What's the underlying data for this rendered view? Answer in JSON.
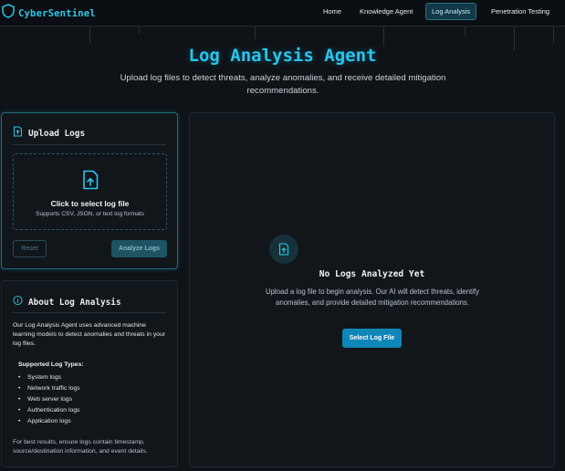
{
  "nav": {
    "brand": "CyberSentinel",
    "links": [
      {
        "label": "Home"
      },
      {
        "label": "Knowledge Agent"
      },
      {
        "label": "Log Analysis"
      },
      {
        "label": "Penetration Testing"
      }
    ],
    "active": "Log Analysis"
  },
  "hero": {
    "title": "Log Analysis Agent",
    "subtitle": "Upload log files to detect threats, analyze anomalies, and receive detailed mitigation recommendations."
  },
  "upload": {
    "title": "Upload Logs",
    "dropzone_title": "Click to select log file",
    "dropzone_sub": "Supports CSV, JSON, or text log formats",
    "reset_label": "Reset",
    "analyze_label": "Analyze Logs"
  },
  "about": {
    "title": "About Log Analysis",
    "text": "Our Log Analysis Agent uses advanced machine learning models to detect anomalies and threats in your log files.",
    "types_title": "Supported Log Types:",
    "types": [
      "System logs",
      "Network traffic logs",
      "Web server logs",
      "Authentication logs",
      "Application logs"
    ],
    "footer": "For best results, ensure logs contain timestamp, source/destination information, and event details."
  },
  "results": {
    "empty_title": "No Logs Analyzed Yet",
    "empty_text": "Upload a log file to begin analysis. Our AI will detect threats, identify anomalies, and provide detailed mitigation recommendations.",
    "select_label": "Select Log File"
  },
  "colors": {
    "accent": "#27c6ee",
    "background": "#0f1216",
    "panel": "#11161b",
    "button_primary": "#0e86b8"
  },
  "icons": {
    "brand": "shield-icon",
    "upload": "file-upload-icon",
    "about": "info-icon"
  }
}
